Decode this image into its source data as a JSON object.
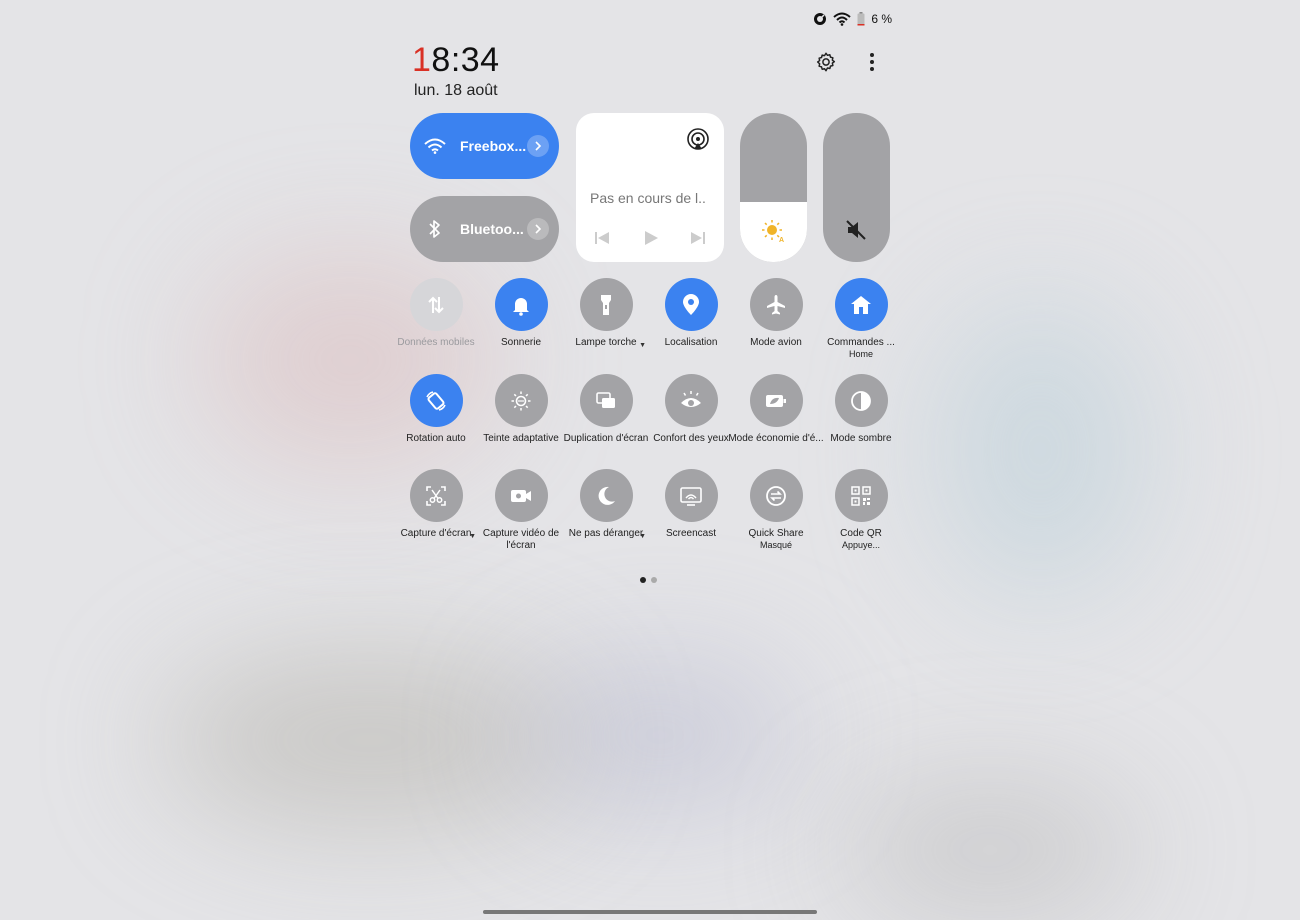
{
  "status_bar": {
    "battery_text": "6 %"
  },
  "header": {
    "time_first": "1",
    "time_rest": "8:34",
    "date": "lun. 18 août"
  },
  "big_tiles": {
    "wifi": {
      "label": "Freebox...",
      "state": "on"
    },
    "bluetooth": {
      "label": "Bluetoo...",
      "state": "off"
    }
  },
  "media": {
    "title": "Pas en cours de l.."
  },
  "sliders": {
    "brightness_level": 0.4,
    "volume_muted": true
  },
  "tiles": [
    {
      "label": "Données mobiles",
      "state": "disabled",
      "icon": "mobile-data-icon"
    },
    {
      "label": "Sonnerie",
      "state": "on",
      "icon": "bell-icon"
    },
    {
      "label": "Lampe torche",
      "state": "off",
      "icon": "flashlight-icon",
      "dropdown": true
    },
    {
      "label": "Localisation",
      "state": "on",
      "icon": "location-pin-icon"
    },
    {
      "label": "Mode avion",
      "state": "off",
      "icon": "airplane-icon"
    },
    {
      "label": "Commandes ...",
      "sub": "Home",
      "state": "on",
      "icon": "home-icon"
    },
    {
      "label": "Rotation auto",
      "state": "on",
      "icon": "auto-rotate-icon"
    },
    {
      "label": "Teinte adaptative",
      "state": "off",
      "icon": "adaptive-tint-icon"
    },
    {
      "label": "Duplication d'écran",
      "state": "off",
      "icon": "screen-mirror-icon"
    },
    {
      "label": "Confort des yeux",
      "state": "off",
      "icon": "eye-icon"
    },
    {
      "label": "Mode économie d'é...",
      "state": "off",
      "icon": "battery-saver-icon"
    },
    {
      "label": "Mode sombre",
      "state": "off",
      "icon": "dark-mode-icon"
    },
    {
      "label": "Capture d'écran",
      "state": "off",
      "icon": "screenshot-scissors-icon",
      "dropdown": true
    },
    {
      "label": "Capture vidéo de l'écran",
      "state": "off",
      "icon": "screen-record-icon"
    },
    {
      "label": "Ne pas déranger",
      "state": "off",
      "icon": "moon-icon",
      "dropdown": true
    },
    {
      "label": "Screencast",
      "state": "off",
      "icon": "screencast-icon"
    },
    {
      "label": "Quick Share",
      "sub": "Masqué",
      "state": "off",
      "icon": "quick-share-icon"
    },
    {
      "label": "Code QR",
      "sub": "Appuye...",
      "state": "off",
      "icon": "qr-code-icon"
    }
  ],
  "pager": {
    "pages": 2,
    "active": 1
  },
  "colors": {
    "accent": "#3b82f0",
    "tile_off": "#a3a3a6",
    "clock_first_digit": "#d93025"
  }
}
